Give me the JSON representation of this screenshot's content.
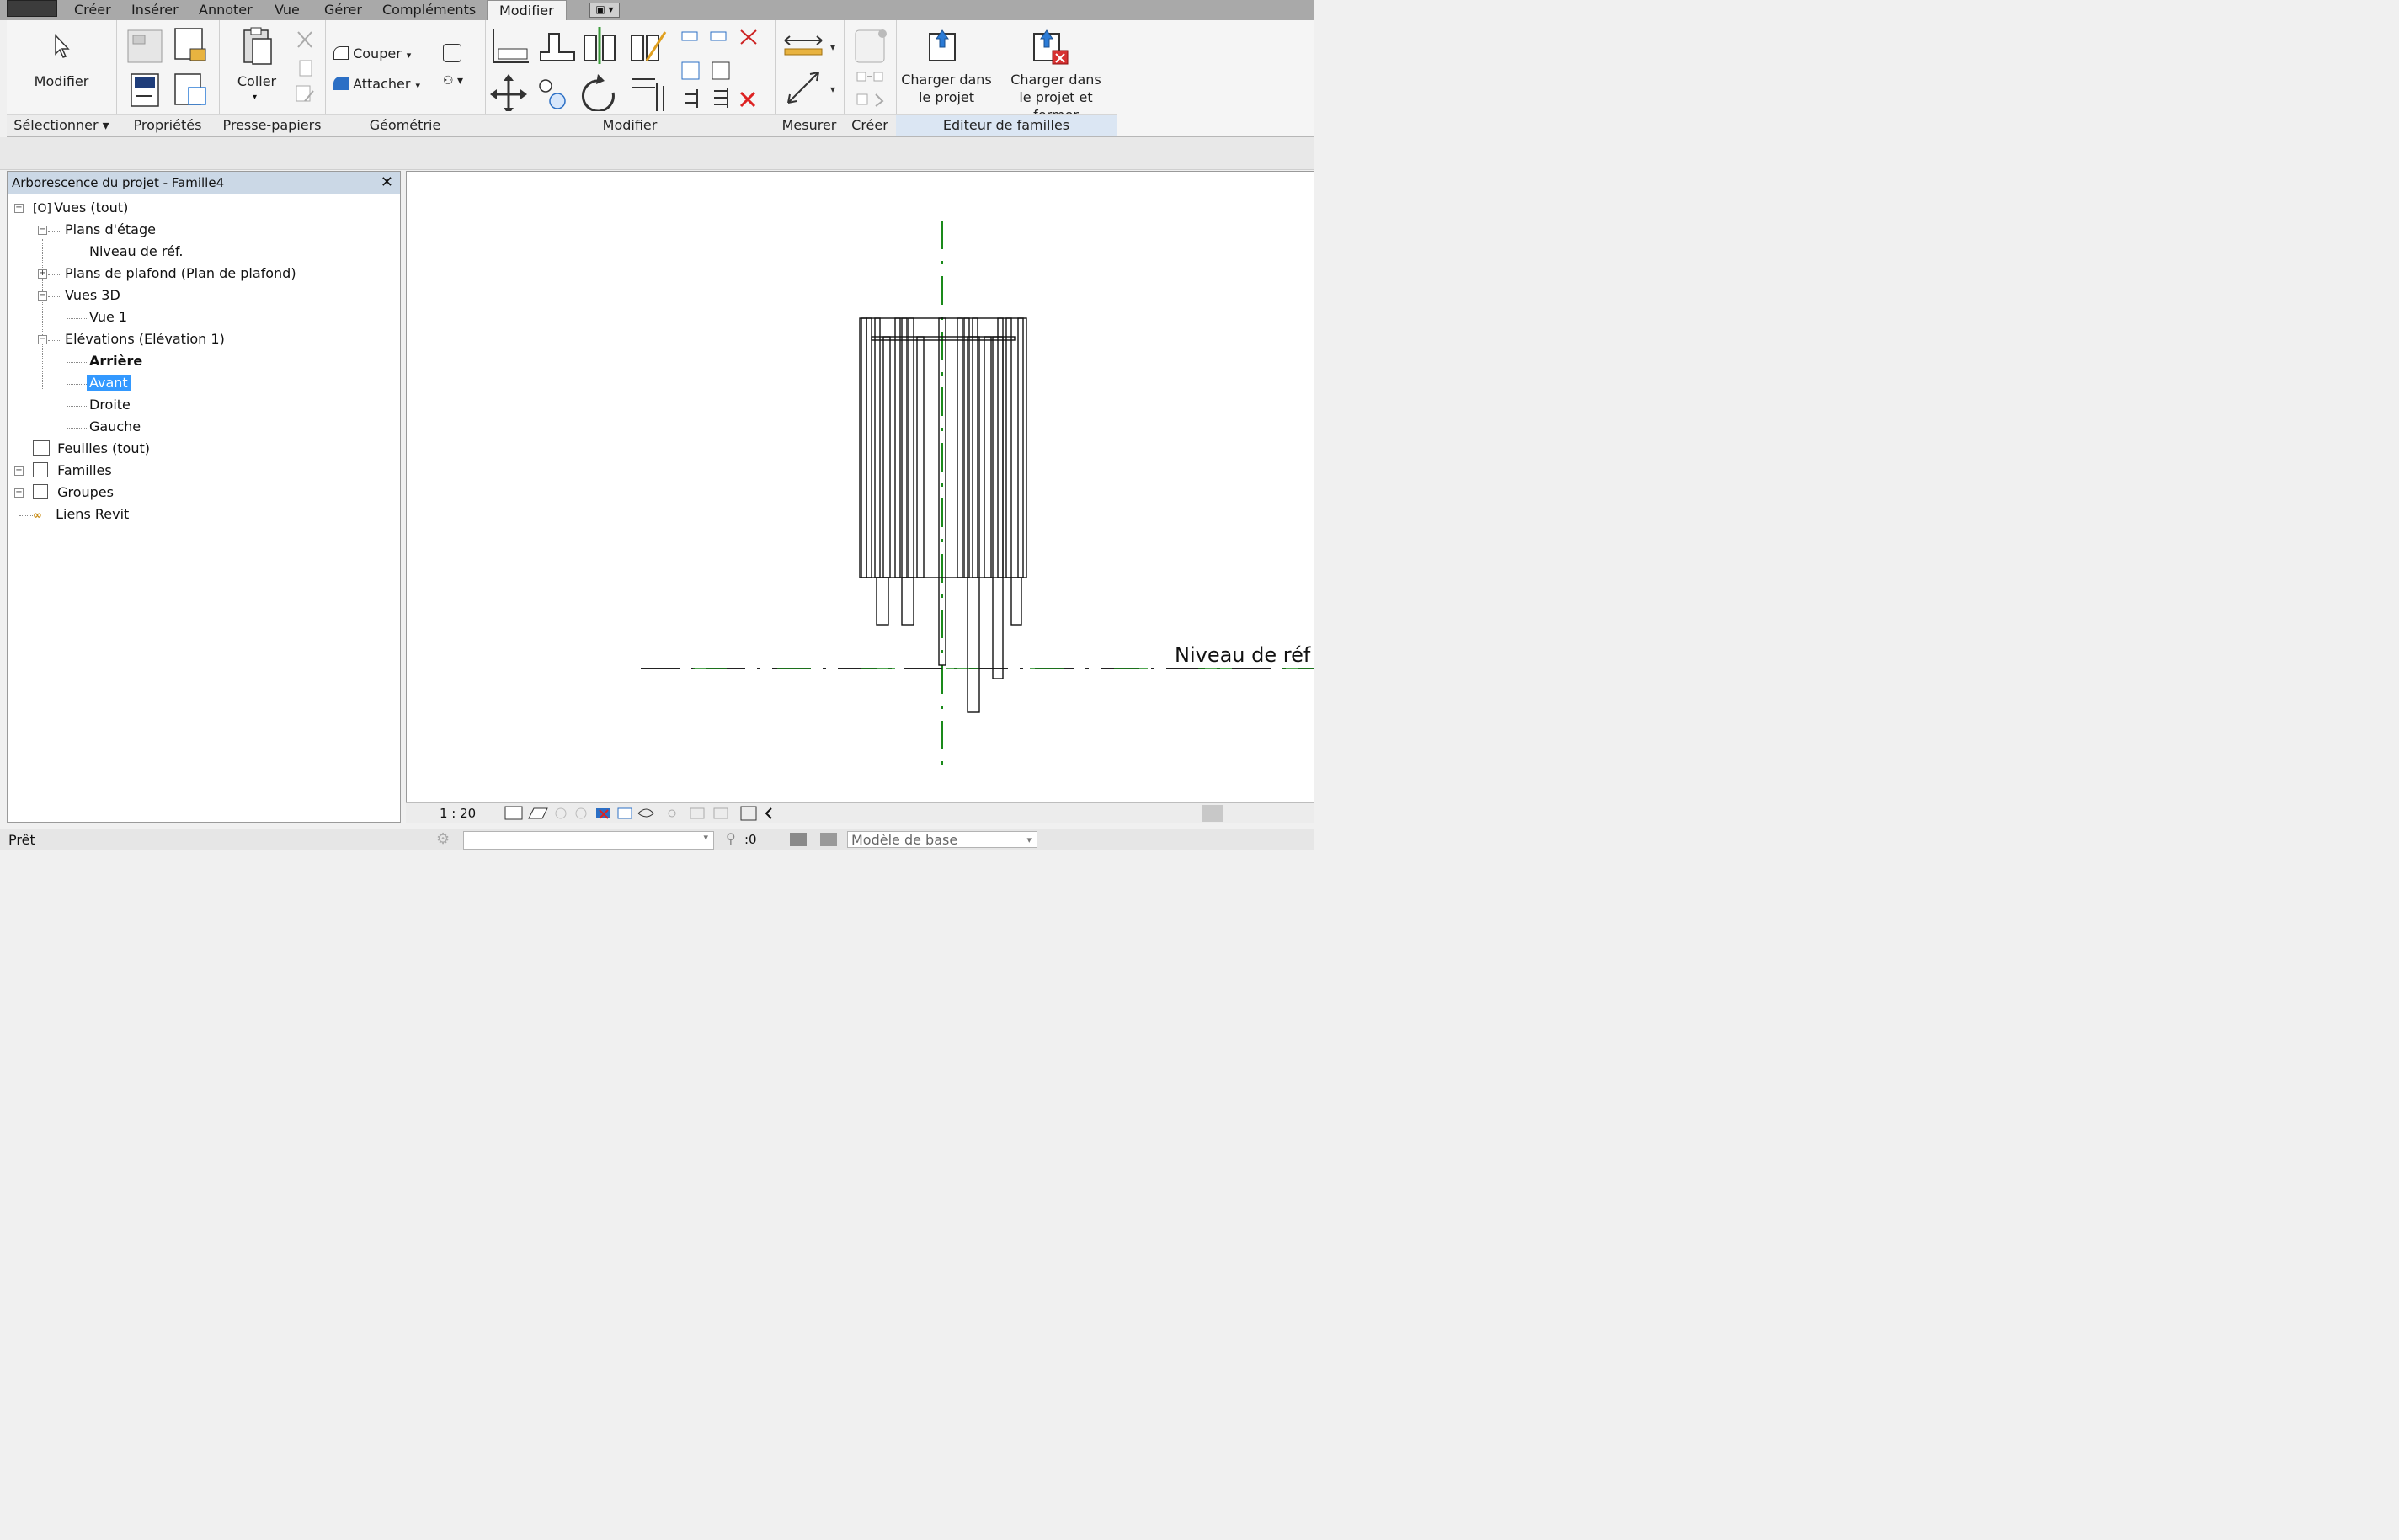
{
  "menu": {
    "tabs": [
      "Créer",
      "Insérer",
      "Annoter",
      "Vue",
      "Gérer",
      "Compléments"
    ],
    "active_tab": "Modifier"
  },
  "ribbon": {
    "select": {
      "modify_label": "Modifier",
      "title": "Sélectionner ▾"
    },
    "properties": {
      "title": "Propriétés"
    },
    "clipboard": {
      "paste_label": "Coller",
      "title": "Presse-papiers"
    },
    "geometry": {
      "cut_label": "Couper",
      "join_label": "Attacher",
      "title": "Géométrie"
    },
    "modify": {
      "title": "Modifier"
    },
    "measure": {
      "title": "Mesurer"
    },
    "create": {
      "title": "Créer"
    },
    "family_editor": {
      "load_line1": "Charger dans",
      "load_line2": "le projet",
      "load_close_line1": "Charger dans",
      "load_close_line2": "le projet et fermer",
      "title": "Editeur de familles"
    }
  },
  "browser": {
    "title": "Arborescence du projet - Famille4",
    "close": "✕",
    "tree": {
      "views_all": "Vues (tout)",
      "floor_plans": "Plans d'étage",
      "ref_level": "Niveau de réf.",
      "ceiling_plans": "Plans de plafond (Plan de plafond)",
      "views_3d": "Vues 3D",
      "view1": "Vue 1",
      "elevations": "Elévations (Elévation 1)",
      "back": "Arrière",
      "front": "Avant",
      "right": "Droite",
      "left": "Gauche",
      "sheets": "Feuilles (tout)",
      "families": "Familles",
      "groups": "Groupes",
      "revit_links": "Liens Revit"
    }
  },
  "view": {
    "level_label": "Niveau de réf",
    "scale": "1 : 20"
  },
  "status": {
    "text": "Prêt",
    "selection_count": ":0",
    "model": "Modèle de base"
  },
  "colors": {
    "ref_line_green": "#1a8a1a",
    "selection_blue": "#3399ff",
    "panel_header": "#cbd8e6"
  }
}
